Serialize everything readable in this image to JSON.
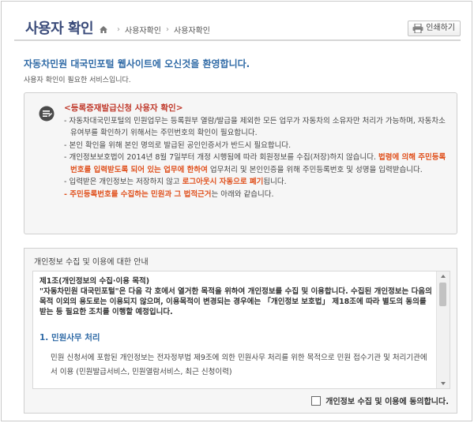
{
  "header": {
    "title": "사용자 확인",
    "breadcrumb": [
      "사용자확인",
      "사용자확인"
    ],
    "print_label": "인쇄하기"
  },
  "welcome": {
    "title": "자동차민원 대국민포털 웹사이트에 오신것을 환영합니다.",
    "subtitle": "사용자 확인이 필요한 서비스입니다."
  },
  "notice": {
    "title": "<등록증재발급신청 사용자 확인>",
    "line1": "- 자동차대국민포털의 민원업무는 등록원부 열람/발급을 제외한 모든 업무가 자동차의 소유자만 처리가 가능하며, 자동차소유여부를 확인하기 위해서는 주민번호의 확인이 필요합니다.",
    "line2": "- 본인 확인을 위해 본인 명의로 발급된 공인인증서가 반드시 필요합니다.",
    "line3_a": "- 개인정보보호법이 2014년 8월 7일부터 개정 시행됨에 따라 회원정보를 수집(저장)하지 않습니다. ",
    "line3_b": "법령에 의해 주민등록번호를 입력받도록 되어 있는 업무에 한하여",
    "line3_c": " 업무처리 및 본인인증을 위해 주민등록번호 및 성명을 입력받습니다.",
    "line4_a": "- 입력받은 개인정보는 저장하지 않고 ",
    "line4_b": "로그아웃시 자동으로 폐기",
    "line4_c": "됩니다.",
    "line5_a": "- 주민등록번호를 수집하는 민원과 그 법적근거",
    "line5_b": "는 아래와 같습니다."
  },
  "privacy": {
    "heading": "개인정보 수집 및 이용에 대한 안내",
    "article_title": "제1조(개인정보의 수집·이용 목적)",
    "article_body": "\"자동차민원 대국민포털\"은 다음 각 호에서 열거한 목적을 위하여 개인정보를 수집 및 이용합니다. 수집된 개인정보는 다음의 목적 이외의 용도로는 이용되지 않으며, 이용목적이 변경되는 경우에는 「개인정보 보호법」 제18조에 따라 별도의 동의를 받는 등 필요한 조치를 이행할 예정입니다.",
    "section_title": "1. 민원사무 처리",
    "section_body": "민원 신청서에 포함된 개인정보는 전자정부법 제9조에 의한 민원사무 처리를 위한 목적으로 민원 접수기관 및 처리기관에서 이용 (민원발급서비스, 민원열람서비스, 최근 신청이력)",
    "agree_label": "개인정보 수집 및 이용에 동의합니다."
  },
  "colors": {
    "title": "#3a4b7a",
    "link_blue": "#2f6aa6",
    "highlight": "#e0521f",
    "notice_title": "#c0392b"
  },
  "icons": [
    "home-icon",
    "printer-icon",
    "note-icon",
    "scroll-up-icon",
    "scroll-down-icon"
  ]
}
